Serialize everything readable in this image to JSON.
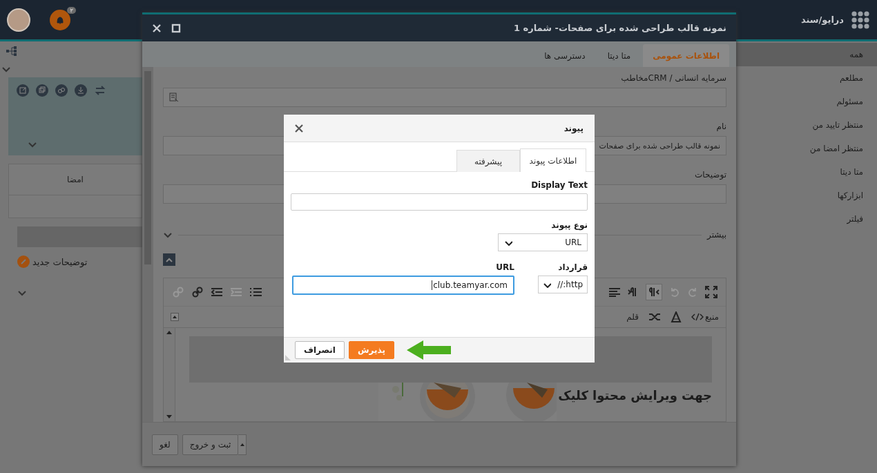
{
  "app": {
    "title": "درایو/سند",
    "notification_count": "۲"
  },
  "sidebar": {
    "items": [
      {
        "label": "همه",
        "selected": true
      },
      {
        "label": "مطلعم",
        "selected": false
      },
      {
        "label": "مسئولم",
        "selected": false
      },
      {
        "label": "منتظر تایید من",
        "selected": false
      },
      {
        "label": "منتظر امضا من",
        "selected": false
      },
      {
        "label": "متا دیتا",
        "selected": false
      },
      {
        "label": "ابزارکها",
        "selected": false
      },
      {
        "label": "فیلتر",
        "selected": false
      }
    ]
  },
  "left_panel": {
    "table_header": "امضا",
    "new_note": "توضیحات جدید"
  },
  "window": {
    "title": "نمونه قالب طراحی شده برای صفحات- شماره 1",
    "tabs": [
      {
        "label": "اطلاعات عمومی",
        "selected": true
      },
      {
        "label": "متا دیتا",
        "selected": false
      },
      {
        "label": "دسترسی ها",
        "selected": false
      }
    ],
    "fields": [
      {
        "label": "مخاطبCRM / سرمایه انسانی",
        "kind": "picker"
      },
      {
        "label": "نام",
        "value": "نمونه قالب طراحی شده برای صفحات",
        "kind": "text"
      },
      {
        "label": "توضیحات",
        "kind": "text"
      }
    ],
    "more": "بیشتر",
    "editor": {
      "source": "منبع",
      "font": "قلم",
      "content_heading": "جهت ویرایش محتوا کلیک"
    },
    "buttons": [
      {
        "label": "ثبت و خروج",
        "kind": "split"
      },
      {
        "label": "لغو",
        "kind": "plain"
      }
    ]
  },
  "dialog": {
    "title": "پیوند",
    "tabs": [
      {
        "label": "اطلاعات پیوند",
        "selected": true
      },
      {
        "label": "پیشرفته",
        "selected": false
      }
    ],
    "display_text_label": "Display Text",
    "link_type_label": "نوع پیوند",
    "link_type": "URL",
    "protocol_label": "قرارداد",
    "protocol": "http://",
    "url_label": "URL",
    "url": "club.teamyar.com",
    "buttons": [
      {
        "label": "پذیرش",
        "kind": "primary"
      },
      {
        "label": "انصراف",
        "kind": "secondary"
      }
    ]
  }
}
